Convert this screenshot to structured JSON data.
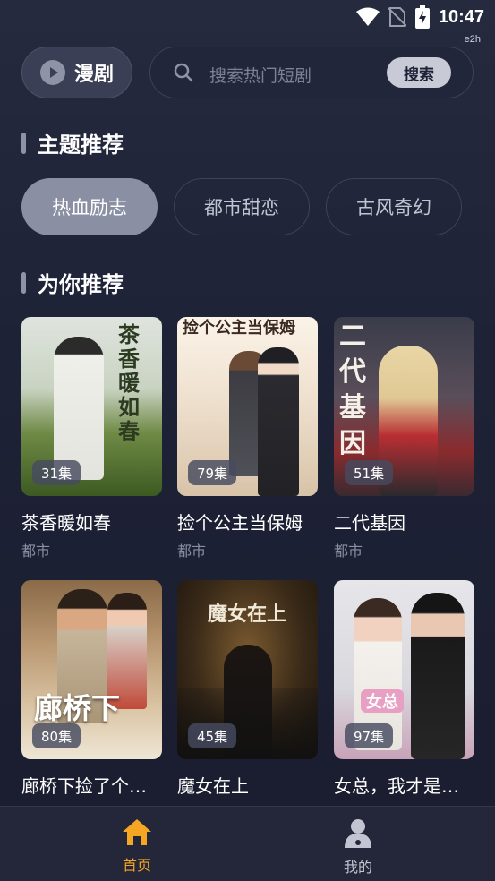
{
  "status_bar": {
    "time": "10:47",
    "tag": "e2h"
  },
  "header": {
    "mode_label": "漫剧",
    "search_placeholder": "搜索热门短剧",
    "search_button": "搜索"
  },
  "topics": {
    "title": "主题推荐",
    "items": [
      {
        "label": "热血励志",
        "active": true
      },
      {
        "label": "都市甜恋",
        "active": false
      },
      {
        "label": "古风奇幻",
        "active": false
      }
    ]
  },
  "recommend": {
    "title": "为你推荐",
    "cards": [
      {
        "title": "茶香暖如春",
        "category": "都市",
        "episodes": "31集",
        "poster_text": "茶香暖如春"
      },
      {
        "title": "捡个公主当保姆",
        "category": "都市",
        "episodes": "79集",
        "poster_text": "捡个公主当保姆"
      },
      {
        "title": "二代基因",
        "category": "都市",
        "episodes": "51集",
        "poster_text": "二代基因"
      },
      {
        "title": "廊桥下捡了个…",
        "category": "",
        "episodes": "80集",
        "poster_text": "廊桥下"
      },
      {
        "title": "魔女在上",
        "category": "",
        "episodes": "45集",
        "poster_text": "魔女在上"
      },
      {
        "title": "女总，我才是…",
        "category": "",
        "episodes": "97集",
        "poster_text": "女总"
      }
    ]
  },
  "bottom_nav": {
    "items": [
      {
        "label": "首页",
        "icon": "home-icon",
        "active": true
      },
      {
        "label": "我的",
        "icon": "user-icon",
        "active": false
      }
    ]
  },
  "colors": {
    "accent": "#f5a623",
    "background": "#1e2236",
    "inactive_text": "#c2c5d1"
  }
}
